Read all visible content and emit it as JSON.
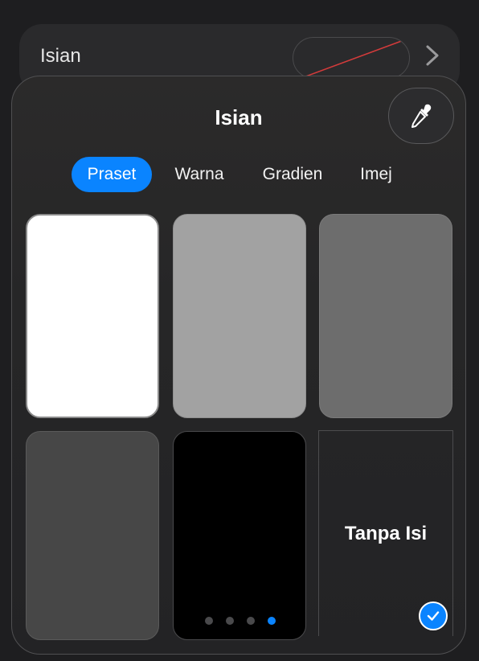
{
  "background_row": {
    "label": "Isian",
    "chevron_icon": "chevron-right-icon",
    "swatch_icon": "no-fill-swatch-icon"
  },
  "popover": {
    "title": "Isian",
    "eyedropper_icon": "eyedropper-icon",
    "tabs": [
      {
        "label": "Praset",
        "active": true
      },
      {
        "label": "Warna",
        "active": false
      },
      {
        "label": "Gradien",
        "active": false
      },
      {
        "label": "Imej",
        "active": false
      }
    ],
    "presets": [
      {
        "name": "white",
        "color": "#ffffff"
      },
      {
        "name": "light-gray",
        "color": "#a2a2a2"
      },
      {
        "name": "medium-gray",
        "color": "#6d6d6d"
      },
      {
        "name": "dark-gray",
        "color": "#474747"
      },
      {
        "name": "black",
        "color": "#000000"
      }
    ],
    "no_fill": {
      "label": "Tanpa Isi",
      "selected": true,
      "check_icon": "checkmark-icon"
    },
    "page_indicator": {
      "count": 4,
      "active_index": 3
    }
  },
  "colors": {
    "accent": "#0a84ff"
  }
}
